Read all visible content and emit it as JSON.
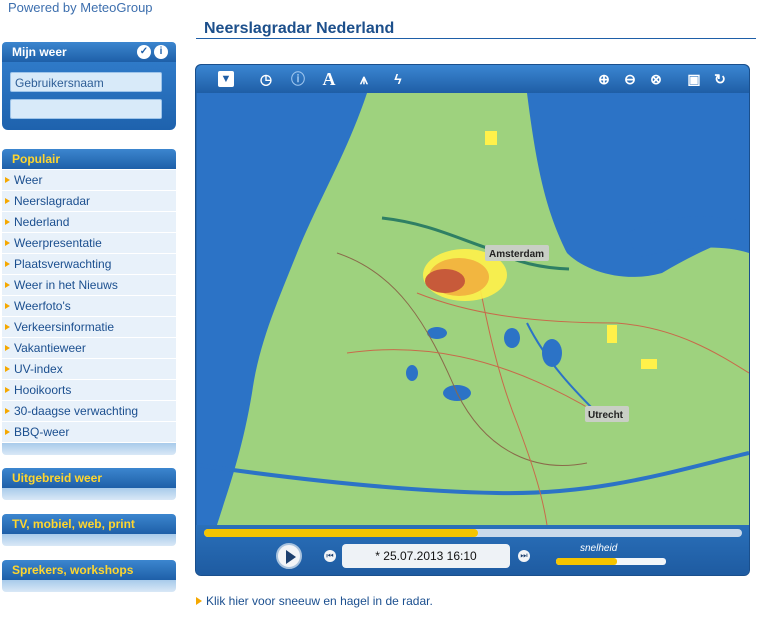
{
  "brand": "Powered by MeteoGroup",
  "sidebar": {
    "mijn_weer": {
      "title": "Mijn weer",
      "username_placeholder": "Gebruikersnaam",
      "password_placeholder": ""
    },
    "populair_title": "Populair",
    "items": [
      {
        "label": "Weer"
      },
      {
        "label": "Neerslagradar"
      },
      {
        "label": "Nederland"
      },
      {
        "label": "Weerpresentatie"
      },
      {
        "label": "Plaatsverwachting"
      },
      {
        "label": "Weer in het Nieuws"
      },
      {
        "label": "Weerfoto's"
      },
      {
        "label": "Verkeersinformatie"
      },
      {
        "label": "Vakantieweer"
      },
      {
        "label": "UV-index"
      },
      {
        "label": "Hooikoorts"
      },
      {
        "label": "30-daagse verwachting"
      },
      {
        "label": "BBQ-weer"
      }
    ],
    "sections": [
      {
        "label": "Uitgebreid weer"
      },
      {
        "label": "TV, mobiel, web, print"
      },
      {
        "label": "Sprekers, workshops"
      }
    ]
  },
  "main": {
    "title": "Neerslagradar Nederland",
    "map": {
      "labels": [
        "Amsterdam",
        "Utrecht"
      ],
      "colors": {
        "land": "#9ed27e",
        "water": "#2c73c6",
        "rain_light": "#fff14a",
        "rain_mid": "#f2b640",
        "rain_heavy": "#c75a3a"
      }
    },
    "controls": {
      "datetime": "* 25.07.2013 16:10",
      "speed_label": "snelheid",
      "timeline_progress": 0.51,
      "speed_progress": 0.55
    },
    "footer_link": "Klik hier voor sneeuw en hagel in de radar."
  }
}
